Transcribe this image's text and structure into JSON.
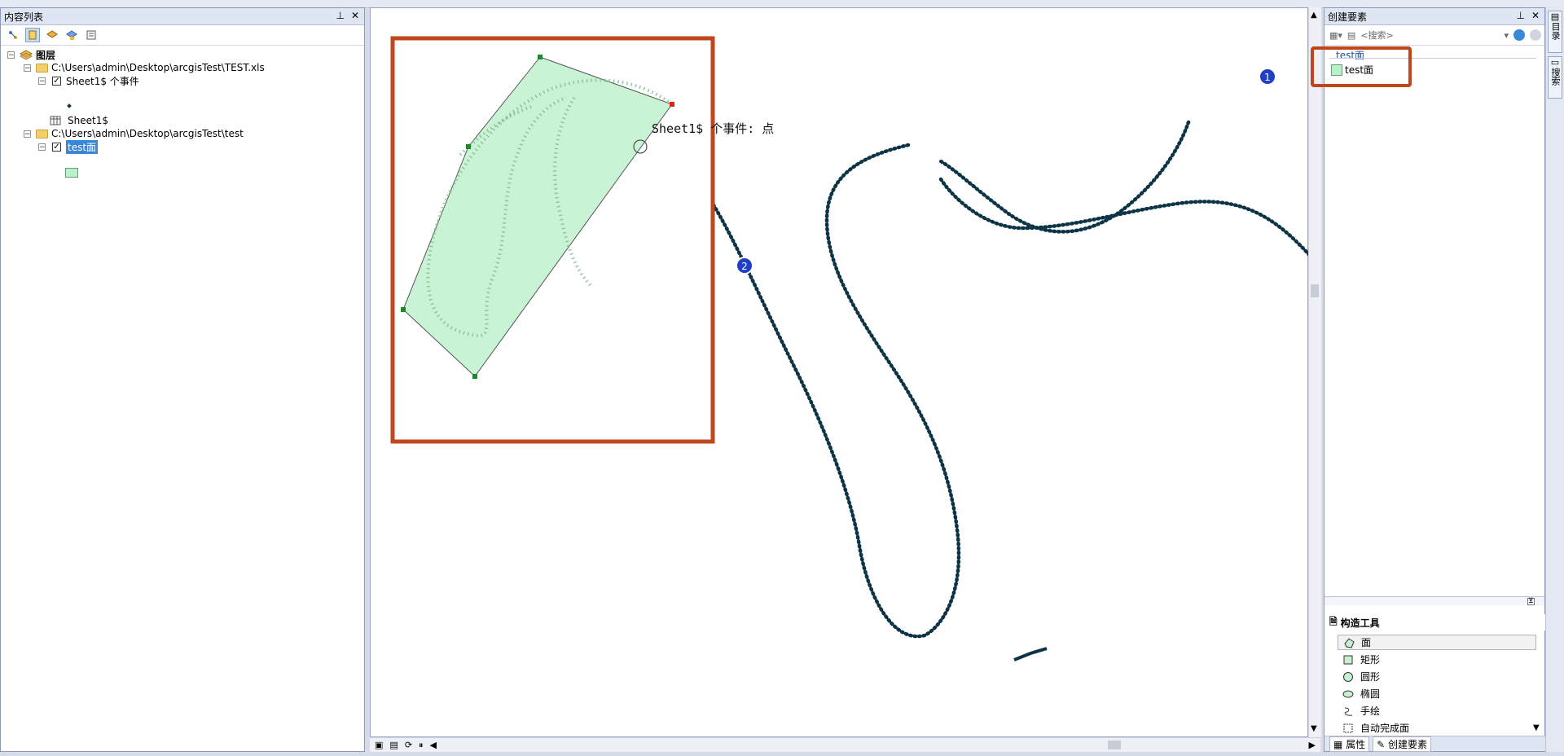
{
  "toc": {
    "title": "内容列表",
    "pin": "ᵖ",
    "close": "✕",
    "root_label": "图层",
    "items": [
      {
        "label": "C:\\Users\\admin\\Desktop\\arcgisTest\\TEST.xls"
      },
      {
        "label": "Sheet1$ 个事件"
      },
      {
        "label": "Sheet1$"
      },
      {
        "label": "C:\\Users\\admin\\Desktop\\arcgisTest\\test"
      },
      {
        "label": "test面"
      }
    ]
  },
  "map": {
    "snap_label": "Sheet1$ 个事件: 点",
    "marker1": "1",
    "marker2": "2"
  },
  "create_panel": {
    "title": "创建要素",
    "search_placeholder": "<搜索>",
    "template_group": "test面",
    "template_item": "test面"
  },
  "construction": {
    "title": "构造工具",
    "tools": [
      "面",
      "矩形",
      "圆形",
      "椭圆",
      "手绘",
      "自动完成面"
    ]
  },
  "bottom_tabs": [
    "属性",
    "创建要素"
  ],
  "side_tabs": [
    "目录",
    "搜索"
  ],
  "colors": {
    "polygon_fill": "#b8f0c8",
    "highlight_box": "#c0461e",
    "track": "#0d3346",
    "selected": "#3a86d7"
  }
}
